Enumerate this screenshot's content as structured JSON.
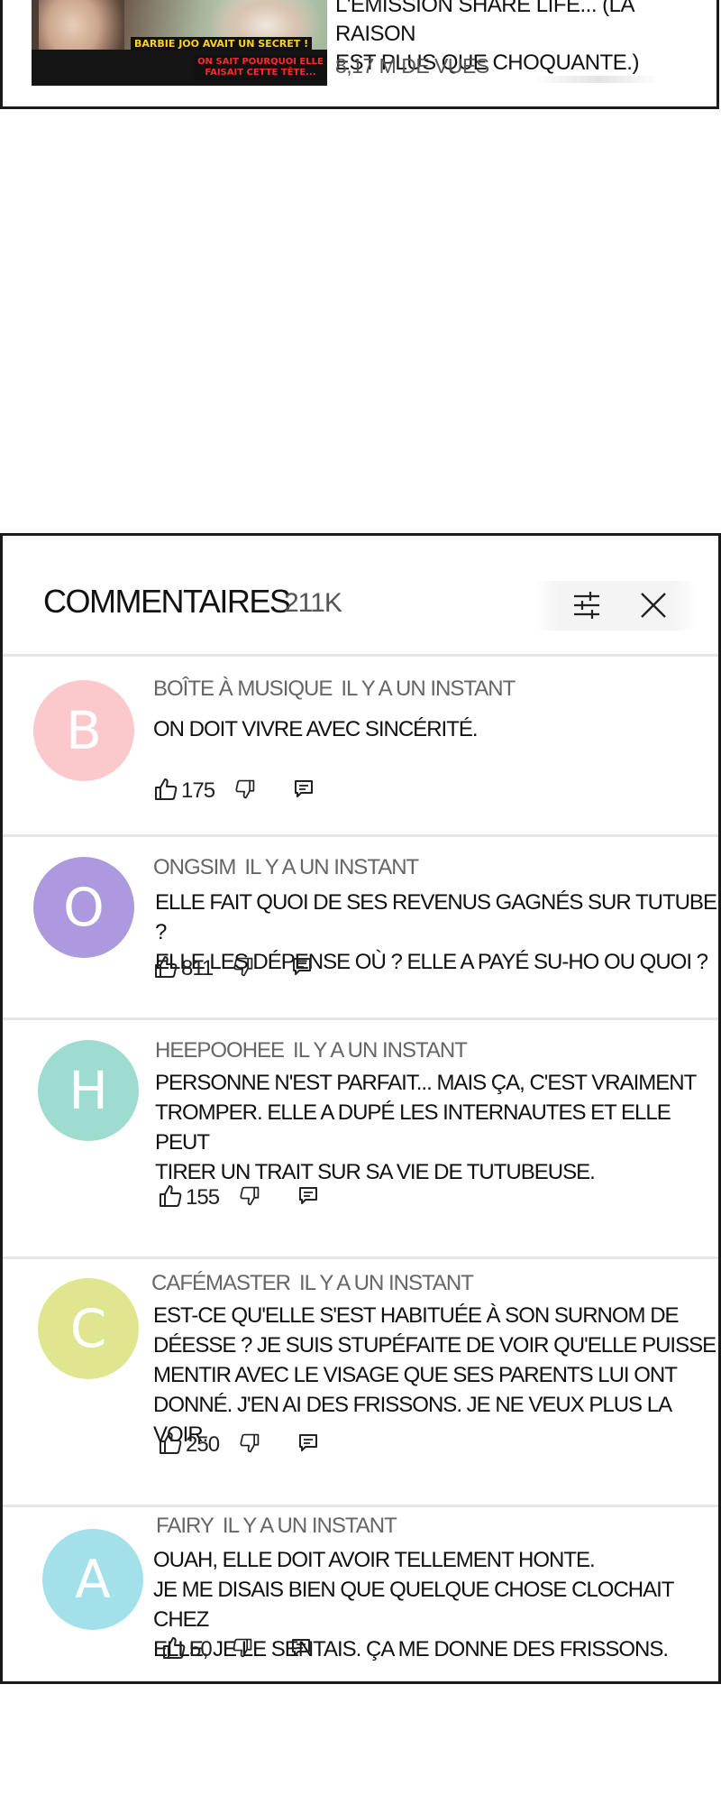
{
  "video": {
    "thumbnail_caption_yellow": "BARBIE JOO AVAIT UN SECRET !",
    "thumbnail_caption_red": "ON SAIT POURQUOI ELLE FAISAIT CETTE TÊTE...",
    "title_line1": "L'ÉMISSION SHARE LIFE... (LA RAISON",
    "title_line2": "EST PLUS QUE CHOQUANTE.)",
    "views": "8,17 M DE VUES"
  },
  "comments_panel": {
    "title": "COMMENTAIRES",
    "count": "211K",
    "filter_icon": "sliders-icon",
    "close_icon": "close-icon"
  },
  "comments": [
    {
      "initial": "B",
      "avatar_color": "#fbc8cb",
      "author": "BOÎTE À MUSIQUE",
      "time": "IL Y A UN INSTANT",
      "lines": [
        "ON DOIT VIVRE AVEC SINCÉRITÉ."
      ],
      "likes": "175"
    },
    {
      "initial": "O",
      "avatar_color": "#ad9ade",
      "author": "ONGSIM",
      "time": "IL Y A UN INSTANT",
      "lines": [
        "ELLE FAIT QUOI DE SES REVENUS GAGNÉS SUR TUTUBE ?",
        "ELLE LES DÉPENSE OÙ ? ELLE A PAYÉ SU-HO OU QUOI ?"
      ],
      "likes": "811"
    },
    {
      "initial": "H",
      "avatar_color": "#9fdcd0",
      "author": "HEEPOOHEE",
      "time": "IL Y A UN INSTANT",
      "lines": [
        "PERSONNE N'EST PARFAIT... MAIS ÇA, C'EST VRAIMENT",
        "TROMPER. ELLE A DUPÉ LES INTERNAUTES ET ELLE PEUT",
        "TIRER UN TRAIT SUR SA VIE DE TUTUBEUSE."
      ],
      "likes": "155"
    },
    {
      "initial": "C",
      "avatar_color": "#e0e68f",
      "author": "CAFÉMASTER",
      "time": "IL Y A UN INSTANT",
      "lines": [
        "EST-CE QU'ELLE S'EST HABITUÉE À SON SURNOM DE",
        "DÉESSE ? JE SUIS STUPÉFAITE DE VOIR QU'ELLE PUISSE",
        "MENTIR AVEC LE VISAGE QUE SES PARENTS LUI ONT",
        "DONNÉ. J'EN AI DES FRISSONS. JE NE VEUX PLUS LA VOIR."
      ],
      "likes": "250"
    },
    {
      "initial": "A",
      "avatar_color": "#a3e1ea",
      "author": "FAIRY",
      "time": "IL Y A UN INSTANT",
      "lines": [
        "OUAH, ELLE DOIT AVOIR TELLEMENT HONTE.",
        "JE ME DISAIS BIEN QUE QUELQUE CHOSE CLOCHAIT CHEZ",
        "ELLE, JE LE SENTAIS. ÇA ME DONNE DES FRISSONS."
      ],
      "likes": "50"
    }
  ]
}
